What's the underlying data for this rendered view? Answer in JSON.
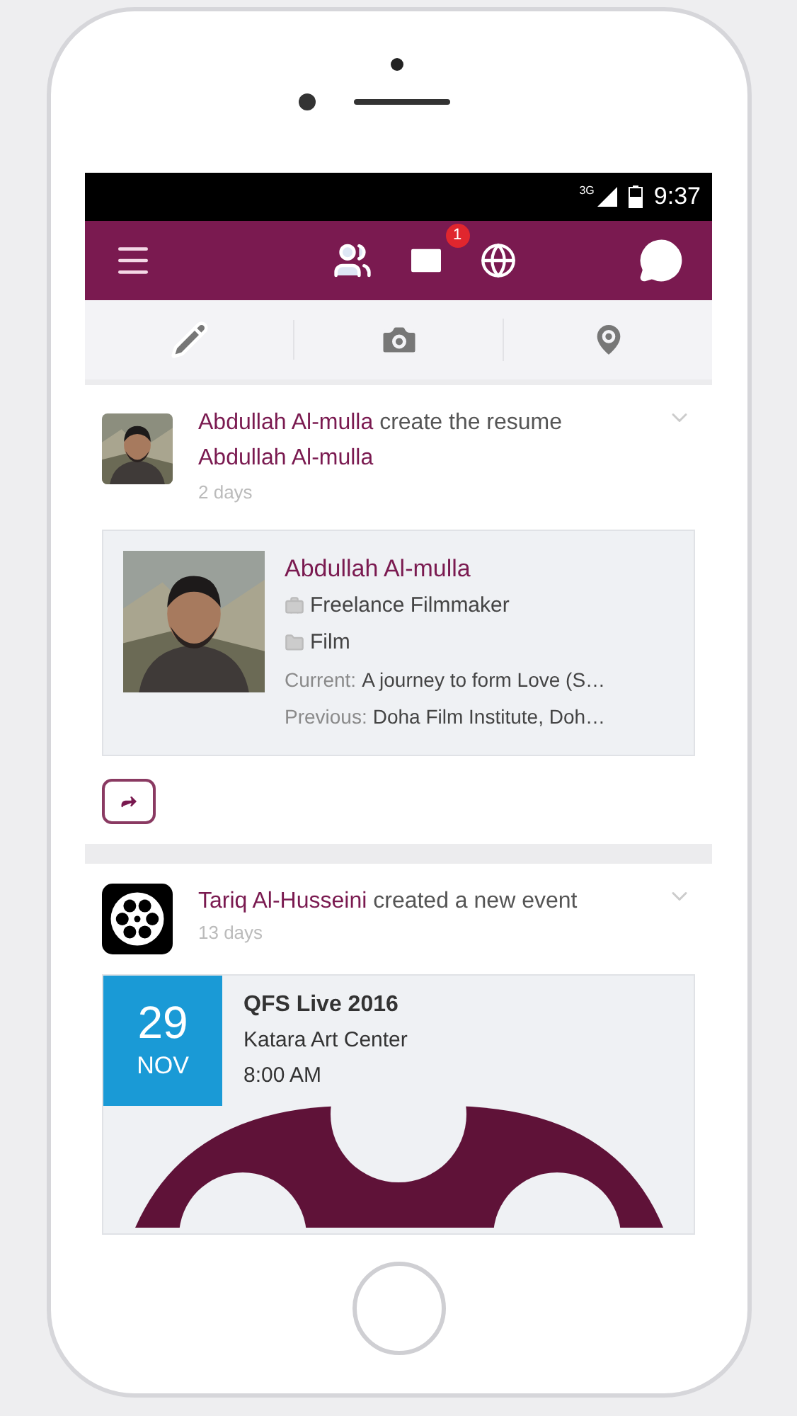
{
  "status_bar": {
    "network": "3G",
    "time": "9:37"
  },
  "app_bar": {
    "mail_badge": "1"
  },
  "posts": [
    {
      "kind": "resume",
      "author": "Abdullah Al-mulla",
      "action": "create the resume",
      "subject": "Abdullah Al-mulla",
      "time": "2 days",
      "resume": {
        "name": "Abdullah Al-mulla",
        "title": "Freelance Filmmaker",
        "field": "Film",
        "current_label": "Current:",
        "current": "A journey to form Love (S…",
        "previous_label": "Previous:",
        "previous": "Doha Film Institute, Doh…"
      }
    },
    {
      "kind": "event",
      "author": "Tariq Al-Husseini",
      "action": "created a new event",
      "time": "13 days",
      "event": {
        "day": "29",
        "month": "NOV",
        "title": "QFS Live 2016",
        "place": "Katara Art Center",
        "time": "8:00 AM"
      }
    }
  ]
}
